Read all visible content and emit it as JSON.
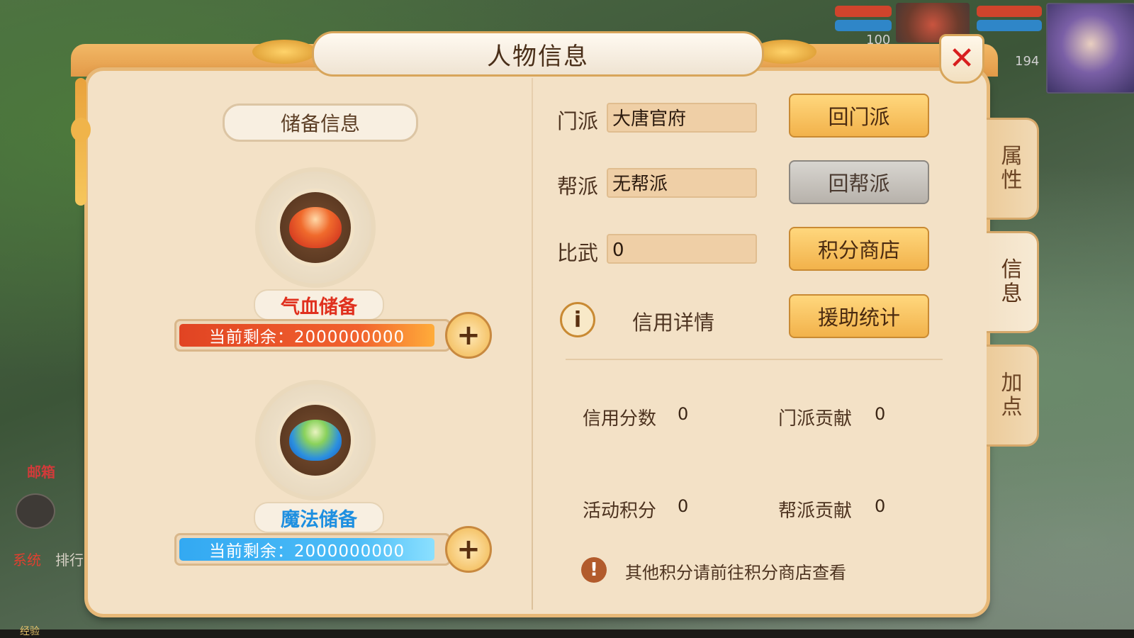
{
  "window": {
    "title": "人物信息",
    "close_icon": "close-icon"
  },
  "hud": {
    "hp_num_1": "100",
    "hp_num_2": "194"
  },
  "background": {
    "mailbox_label": "邮箱",
    "chat_tab": "系统",
    "rank_label": "排行",
    "exp_label": "经验"
  },
  "storage": {
    "title": "储备信息",
    "hp": {
      "label": "气血储备",
      "remain_text": "当前剩余：2000000000",
      "color": "#e0301e"
    },
    "mp": {
      "label": "魔法储备",
      "remain_text": "当前剩余：2000000000",
      "color": "#1e8fe0"
    }
  },
  "info": {
    "rows": [
      {
        "label": "门派",
        "value": "大唐官府",
        "button": "回门派",
        "button_style": "gold"
      },
      {
        "label": "帮派",
        "value": "无帮派",
        "button": "回帮派",
        "button_style": "gray"
      },
      {
        "label": "比武",
        "value": "0",
        "button": "积分商店",
        "button_style": "gold"
      }
    ],
    "credit_link": "信用详情",
    "assist_button": "援助统计",
    "stats": [
      {
        "label": "信用分数",
        "value": "0"
      },
      {
        "label": "门派贡献",
        "value": "0"
      },
      {
        "label": "活动积分",
        "value": "0"
      },
      {
        "label": "帮派贡献",
        "value": "0"
      }
    ],
    "hint": "其他积分请前往积分商店查看"
  },
  "tabs": [
    {
      "label": [
        "属",
        "性"
      ],
      "active": false
    },
    {
      "label": [
        "信",
        "息"
      ],
      "active": true
    },
    {
      "label": [
        "加",
        "点"
      ],
      "active": false
    }
  ]
}
